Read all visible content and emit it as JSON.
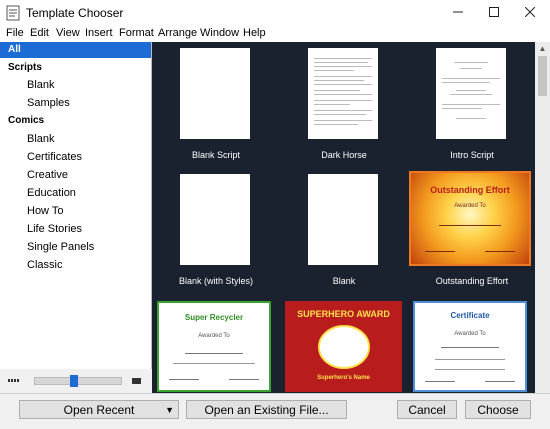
{
  "window": {
    "title": "Template Chooser"
  },
  "menu": [
    "File",
    "Edit",
    "View",
    "Insert",
    "Format",
    "Arrange",
    "Window",
    "Help"
  ],
  "sidebar": {
    "items": [
      {
        "label": "All",
        "kind": "all",
        "selected": true
      },
      {
        "label": "Scripts",
        "kind": "header"
      },
      {
        "label": "Blank",
        "kind": "sub"
      },
      {
        "label": "Samples",
        "kind": "sub"
      },
      {
        "label": "Comics",
        "kind": "header"
      },
      {
        "label": "Blank",
        "kind": "sub"
      },
      {
        "label": "Certificates",
        "kind": "sub"
      },
      {
        "label": "Creative",
        "kind": "sub"
      },
      {
        "label": "Education",
        "kind": "sub"
      },
      {
        "label": "How To",
        "kind": "sub"
      },
      {
        "label": "Life Stories",
        "kind": "sub"
      },
      {
        "label": "Single Panels",
        "kind": "sub"
      },
      {
        "label": "Classic",
        "kind": "sub"
      }
    ],
    "zoom_level": 0.45
  },
  "templates": [
    {
      "label": "Blank Script",
      "style": "blank"
    },
    {
      "label": "Dark Horse",
      "style": "text"
    },
    {
      "label": "Intro Script",
      "style": "text-sparse"
    },
    {
      "label": "Blank (with Styles)",
      "style": "blank"
    },
    {
      "label": "Blank",
      "style": "blank"
    },
    {
      "label": "Outstanding Effort",
      "style": "cert-orange",
      "selected": true,
      "cert_title": "Outstanding Effort",
      "cert_sub": "Awarded To"
    },
    {
      "label": "",
      "style": "cert-green",
      "cert_title": "Super Recycler",
      "cert_sub": "Awarded To"
    },
    {
      "label": "",
      "style": "cert-red",
      "cert_title": "SUPERHERO AWARD",
      "cert_sub": "Superhero's Name"
    },
    {
      "label": "",
      "style": "cert-blue",
      "cert_title": "Certificate",
      "cert_sub": "Awarded To"
    }
  ],
  "buttons": {
    "open_recent": "Open Recent",
    "open_existing": "Open an Existing File...",
    "cancel": "Cancel",
    "choose": "Choose"
  },
  "colors": {
    "accent": "#1d6bd5",
    "grid_bg": "#1a2230",
    "selection": "#f07a22"
  }
}
